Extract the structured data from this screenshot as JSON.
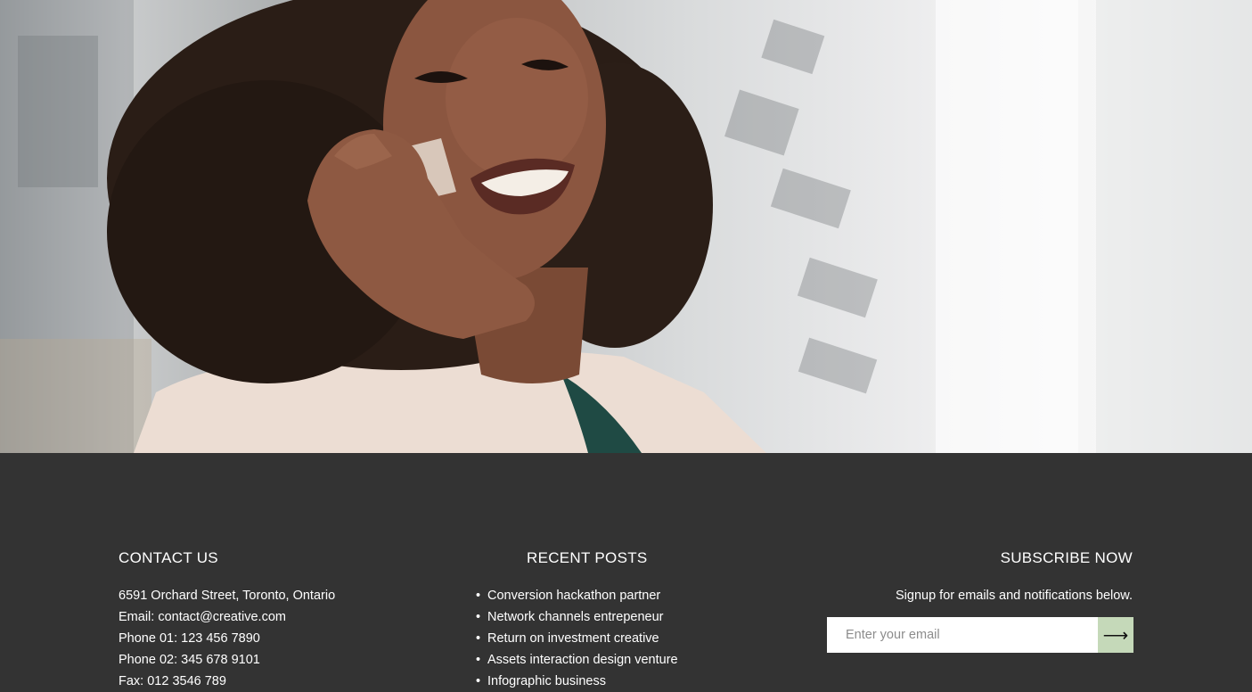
{
  "hero": {
    "image": "woman-smiling-on-phone-photo"
  },
  "footer": {
    "contact": {
      "title": "CONTACT US",
      "address": "6591 Orchard Street, Toronto, Ontario",
      "email": "Email: contact@creative.com",
      "phone1": "Phone 01: 123 456 7890",
      "phone2": "Phone 02: 345 678 9101",
      "fax": "Fax: 012 3546 789"
    },
    "recent_posts": {
      "title": "RECENT POSTS",
      "items": [
        "Conversion hackathon partner",
        "Network channels entrepeneur",
        "Return on investment creative",
        "Assets interaction design venture",
        "Infographic business"
      ]
    },
    "subscribe": {
      "title": "SUBSCRIBE NOW",
      "text": "Signup for emails and notifications below.",
      "placeholder": "Enter your email",
      "button_icon": "arrow-right-icon",
      "button_color": "#c5d9b9"
    }
  }
}
